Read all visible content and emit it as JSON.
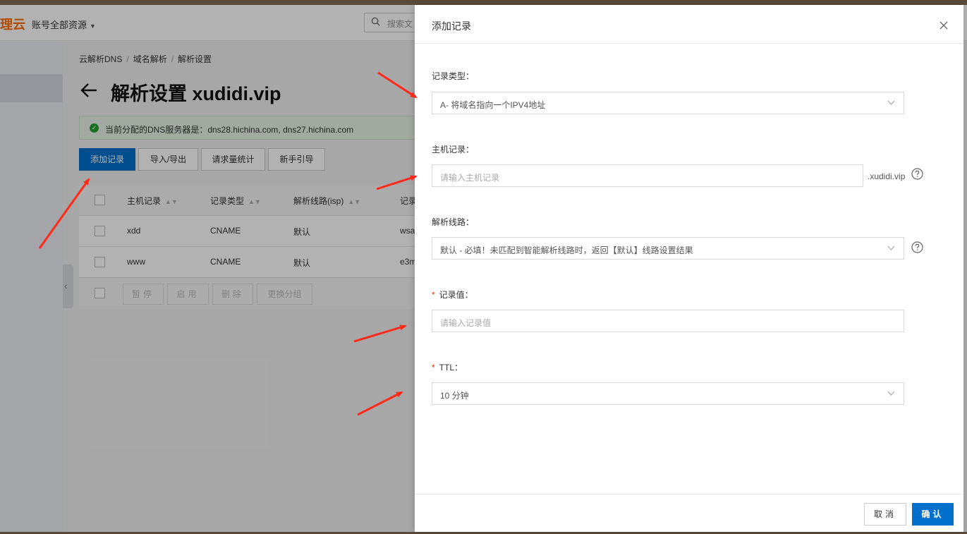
{
  "brand": {
    "logo_text": "理云",
    "color": "#ff6a00"
  },
  "topbar": {
    "account_label": "账号全部资源",
    "search_placeholder": "搜索文"
  },
  "breadcrumb": [
    "云解析DNS",
    "域名解析",
    "解析设置"
  ],
  "page": {
    "title": "解析设置 xudidi.vip",
    "dns_notice": "当前分配的DNS服务器是：dns28.hichina.com, dns27.hichina.com"
  },
  "toolbar": {
    "add_record": "添加记录",
    "import_export": "导入/导出",
    "request_stats": "请求量统计",
    "beginner_guide": "新手引导"
  },
  "table": {
    "columns": [
      "主机记录",
      "记录类型",
      "解析线路(isp)",
      "记录"
    ],
    "rows": [
      {
        "host": "xdd",
        "type": "CNAME",
        "line": "默认",
        "value": "wsa"
      },
      {
        "host": "www",
        "type": "CNAME",
        "line": "默认",
        "value": "e3m"
      }
    ],
    "bulk_actions": [
      "暂停",
      "启用",
      "删除",
      "更换分组"
    ]
  },
  "drawer": {
    "title": "添加记录",
    "fields": {
      "record_type": {
        "label": "记录类型：",
        "value": "A- 将域名指向一个IPV4地址"
      },
      "host_record": {
        "label": "主机记录：",
        "placeholder": "请输入主机记录",
        "suffix": ".xudidi.vip"
      },
      "line": {
        "label": "解析线路：",
        "value": "默认 - 必填！未匹配到智能解析线路时，返回【默认】线路设置结果"
      },
      "record_value": {
        "label": "记录值：",
        "required": "*",
        "placeholder": "请输入记录值"
      },
      "ttl": {
        "label": "TTL：",
        "required": "*",
        "value": "10 分钟"
      }
    },
    "footer": {
      "cancel": "取消",
      "confirm": "确认"
    }
  },
  "colors": {
    "primary": "#0070cc",
    "annotation_arrow": "#ff2a1a",
    "success": "#23a02d",
    "required": "#e5331b"
  }
}
